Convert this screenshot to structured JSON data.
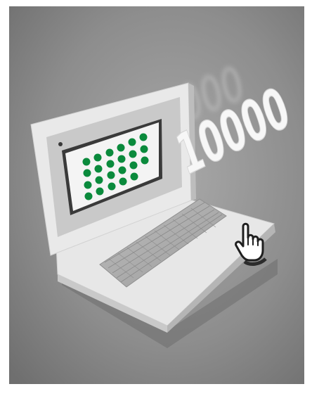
{
  "scene": {
    "counter_text": "10000",
    "ghost_counter_text": "10000",
    "dot_color": "#0a8a3c",
    "background_color": "#8c8c8c",
    "icons": [
      "laptop-icon",
      "hand-pointer-icon"
    ]
  }
}
